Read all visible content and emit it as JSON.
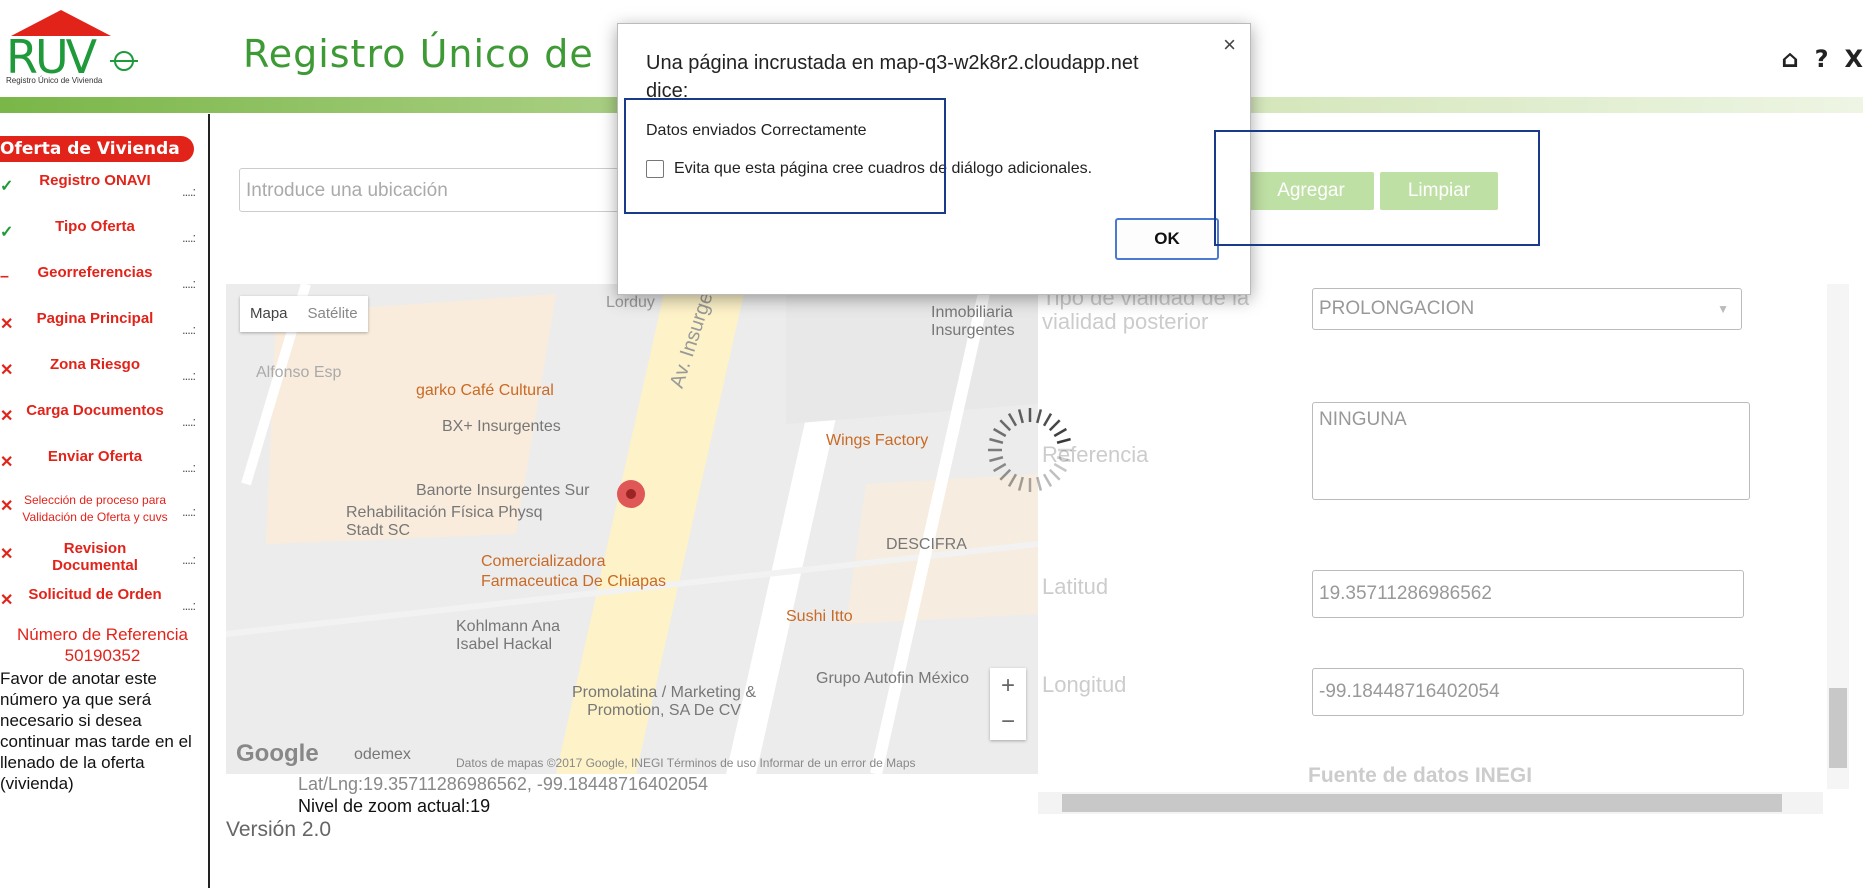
{
  "header": {
    "logo_text": "RUV",
    "logo_sub": "Registro Único de Vivienda",
    "title": "Registro Único de",
    "icons": [
      "home-icon",
      "help-icon",
      "close-icon"
    ],
    "help_glyph": "?",
    "close_glyph": "X",
    "home_glyph": "⌂"
  },
  "sidebar": {
    "heading": "Oferta de Vivienda",
    "steps": [
      {
        "label": "Registro ONAVI",
        "status": "done",
        "mark": "✓"
      },
      {
        "label": "Tipo Oferta",
        "status": "done",
        "mark": "✓"
      },
      {
        "label": "Georreferencias",
        "status": "current",
        "mark": "–"
      },
      {
        "label": "Pagina Principal",
        "status": "pending",
        "mark": "✕"
      },
      {
        "label": "Zona Riesgo",
        "status": "pending",
        "mark": "✕"
      },
      {
        "label": "Carga Documentos",
        "status": "pending",
        "mark": "✕"
      },
      {
        "label": "Enviar Oferta",
        "status": "pending",
        "mark": "✕"
      },
      {
        "label": "Selección de proceso para Validación de Oferta y cuvs",
        "status": "pending",
        "mark": "✕"
      },
      {
        "label": "Revision Documental",
        "status": "pending",
        "mark": "✕"
      },
      {
        "label": "Solicitud de Orden",
        "status": "pending",
        "mark": "✕"
      }
    ],
    "dots": "....:",
    "ref_label": "Número de Referencia",
    "ref_number": "50190352",
    "ref_note": "Favor de anotar este número ya que será necesario si desea continuar mas tarde en el llenado de la oferta (vivienda)"
  },
  "search": {
    "placeholder": "Introduce una ubicación"
  },
  "buttons": {
    "add": "Agregar",
    "clear": "Limpiar"
  },
  "map": {
    "type_map": "Mapa",
    "type_satellite": "Satélite",
    "pois": [
      "garko Café Cultural",
      "BX+ Insurgentes",
      "Banorte Insurgentes Sur",
      "Rehabilitación Física Physq Stadt SC",
      "Comercializadora Farmaceutica De Chiapas",
      "Kohlmann Ana Isabel Hackal",
      "Promolatina / Marketing & Promotion, SA De CV",
      "Inmobiliaria Insurgentes",
      "Wings Factory",
      "DESCIFRA",
      "Sushi Itto",
      "Grupo Autofin México",
      "Av. Insurgentes Sur",
      "Alfonso Esp",
      "odemex",
      "Lorduy"
    ],
    "zoom_in": "+",
    "zoom_out": "−",
    "google": "Google",
    "footer": "Datos de mapas ©2017 Google, INEGI   Términos de uso   Informar de un error de Maps",
    "latlng": "Lat/Lng:19.35711286986562, -99.18448716402054",
    "zoom_level": "Nivel de zoom actual:19"
  },
  "version": "Versión 2.0",
  "form": {
    "vialidad_label": "Tipo de vialidad de la vialidad posterior",
    "vialidad_value": "PROLONGACION",
    "referencia_label": "Referencia",
    "referencia_value": "NINGUNA",
    "latitud_label": "Latitud",
    "latitud_value": "19.35711286986562",
    "longitud_label": "Longitud",
    "longitud_value": "-99.18448716402054",
    "source": "Fuente de datos INEGI"
  },
  "dialog": {
    "title": "Una página incrustada en map-q3-w2k8r2.cloudapp.net dice:",
    "message": "Datos enviados Correctamente",
    "checkbox": "Evita que esta página cree cuadros de diálogo adicionales.",
    "ok": "OK",
    "close": "×"
  },
  "colors": {
    "brand_green": "#3d9a34",
    "alert_red": "#e2231a",
    "button_green": "#bfe0a4"
  }
}
